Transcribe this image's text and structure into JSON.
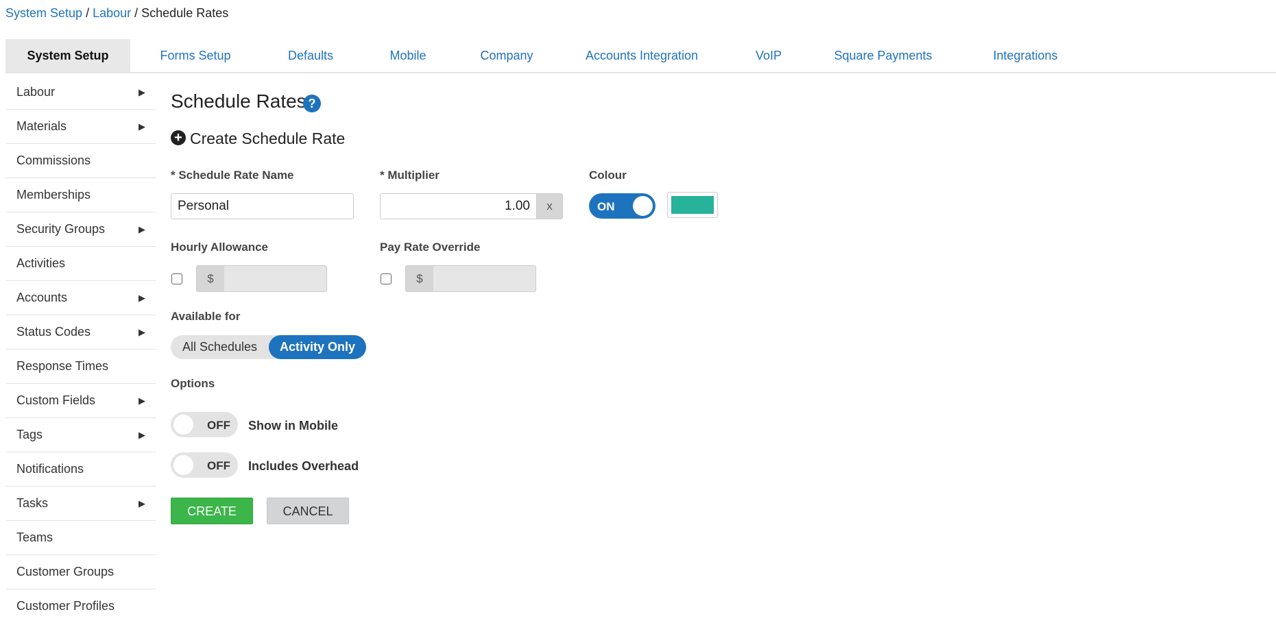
{
  "breadcrumb": {
    "items": [
      "System Setup",
      "Labour",
      "Schedule Rates"
    ],
    "separator": "/"
  },
  "tabs": [
    {
      "label": "System Setup",
      "active": true
    },
    {
      "label": "Forms Setup"
    },
    {
      "label": "Defaults"
    },
    {
      "label": "Mobile"
    },
    {
      "label": "Company"
    },
    {
      "label": "Accounts Integration"
    },
    {
      "label": "VoIP"
    },
    {
      "label": "Square Payments"
    },
    {
      "label": "Integrations"
    }
  ],
  "sidebar": {
    "items": [
      {
        "label": "Labour",
        "has_submenu": true
      },
      {
        "label": "Materials",
        "has_submenu": true
      },
      {
        "label": "Commissions",
        "has_submenu": false
      },
      {
        "label": "Memberships",
        "has_submenu": false
      },
      {
        "label": "Security Groups",
        "has_submenu": true
      },
      {
        "label": "Activities",
        "has_submenu": false
      },
      {
        "label": "Accounts",
        "has_submenu": true
      },
      {
        "label": "Status Codes",
        "has_submenu": true
      },
      {
        "label": "Response Times",
        "has_submenu": false
      },
      {
        "label": "Custom Fields",
        "has_submenu": true
      },
      {
        "label": "Tags",
        "has_submenu": true
      },
      {
        "label": "Notifications",
        "has_submenu": false
      },
      {
        "label": "Tasks",
        "has_submenu": true
      },
      {
        "label": "Teams",
        "has_submenu": false
      },
      {
        "label": "Customer Groups",
        "has_submenu": false
      },
      {
        "label": "Customer Profiles",
        "has_submenu": false
      }
    ],
    "arrow_glyph": "▶"
  },
  "page": {
    "title": "Schedule Rates",
    "help_glyph": "?",
    "create_heading": "Create Schedule Rate",
    "plus_glyph": "+"
  },
  "form": {
    "name_label": "* Schedule Rate Name",
    "name_value": "Personal",
    "multiplier_label": "* Multiplier",
    "multiplier_value": "1.00",
    "multiplier_addon": "x",
    "colour_label": "Colour",
    "colour_toggle": "ON",
    "colour_value": "#26b39a",
    "hourly_label": "Hourly Allowance",
    "hourly_addon": "$",
    "hourly_checked": false,
    "pay_rate_label": "Pay Rate Override",
    "pay_rate_addon": "$",
    "pay_rate_checked": false,
    "available_label": "Available for",
    "available_options": [
      "All Schedules",
      "Activity Only"
    ],
    "available_selected": "Activity Only",
    "options_label": "Options",
    "show_mobile_toggle": "OFF",
    "show_mobile_label": "Show in Mobile",
    "overhead_toggle": "OFF",
    "overhead_label": "Includes Overhead",
    "create_button": "CREATE",
    "cancel_button": "CANCEL"
  },
  "colors": {
    "link": "#1e73be",
    "accent": "#1e73be",
    "create": "#3cb54a",
    "swatch": "#26b39a"
  }
}
